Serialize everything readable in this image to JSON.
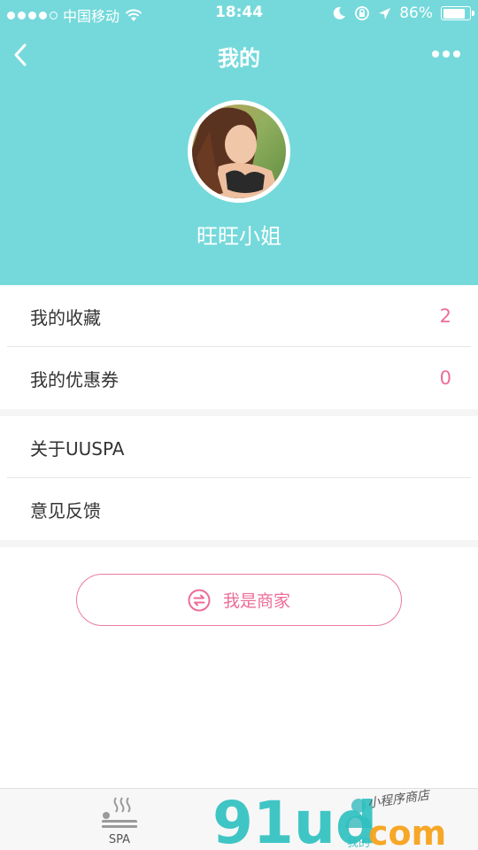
{
  "status_bar": {
    "carrier": "中国移动",
    "time": "18:44",
    "battery": "86%",
    "battery_level": 0.86
  },
  "nav": {
    "title": "我的",
    "back_icon": "chevron-left-icon",
    "more_icon": "more-dots-icon"
  },
  "profile": {
    "name": "旺旺小姐"
  },
  "menu_group_1": [
    {
      "label": "我的收藏",
      "count": "2"
    },
    {
      "label": "我的优惠券",
      "count": "0"
    }
  ],
  "menu_group_2": [
    {
      "label": "关于UUSPA"
    },
    {
      "label": "意见反馈"
    }
  ],
  "merchant_button": {
    "label": "我是商家",
    "icon": "swap-arrows-icon"
  },
  "tabbar": {
    "tabs": [
      {
        "label": "SPA",
        "icon": "spa-icon"
      },
      {
        "label": "我的",
        "icon": "user-icon"
      }
    ]
  },
  "watermark": {
    "logo": "91ud",
    "suffix": "com",
    "tagline": "小程序商店"
  },
  "colors": {
    "header_bg": "#75d9db",
    "accent_pink": "#ec6d98",
    "accent_teal": "#5cc6c9"
  }
}
